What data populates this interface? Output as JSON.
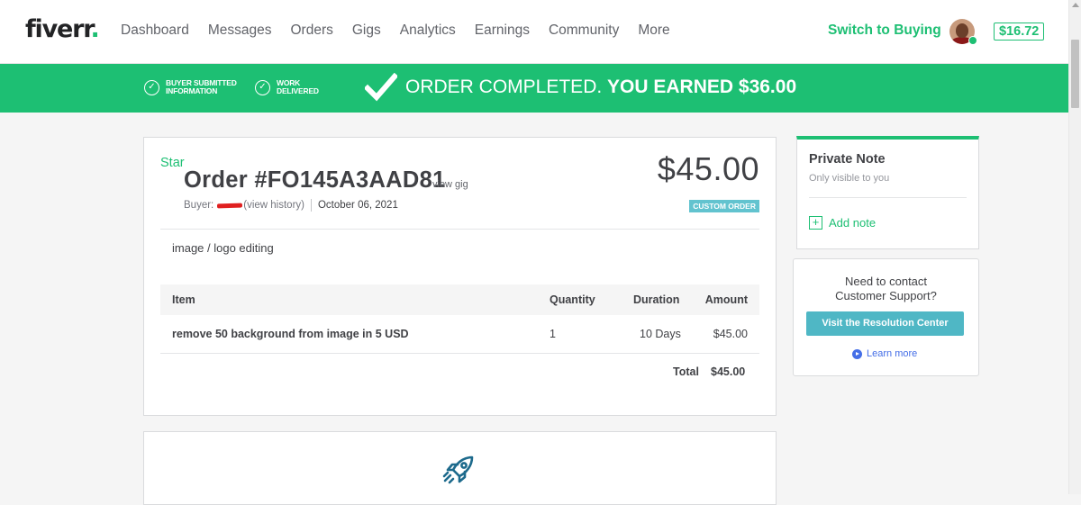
{
  "brand": {
    "logo_text": "fiverr",
    "logo_dot": ".",
    "accent": "#1dbf73"
  },
  "nav": {
    "links": [
      "Dashboard",
      "Messages",
      "Orders",
      "Gigs",
      "Analytics",
      "Earnings",
      "Community",
      "More"
    ],
    "switch_label": "Switch to Buying",
    "balance": "$16.72"
  },
  "banner": {
    "step1_line1": "BUYER SUBMITTED",
    "step1_line2": "INFORMATION",
    "step2_line1": "WORK",
    "step2_line2": "DELIVERED",
    "status_text": "ORDER COMPLETED.",
    "earned_text": "YOU EARNED $36.00"
  },
  "order": {
    "star_label": "Star",
    "title": "Order #FO145A3AAD81",
    "view_gig": "view gig",
    "buyer_label": "Buyer:",
    "view_history": "(view history)",
    "date": "October 06, 2021",
    "price": "$45.00",
    "badge": "CUSTOM ORDER",
    "description": "image / logo editing",
    "columns": {
      "item": "Item",
      "quantity": "Quantity",
      "duration": "Duration",
      "amount": "Amount"
    },
    "row": {
      "item": "remove 50 background from image in 5 USD",
      "quantity": "1",
      "duration": "10 Days",
      "amount": "$45.00"
    },
    "total_label": "Total",
    "total_value": "$45.00"
  },
  "private_note": {
    "title": "Private Note",
    "subtitle": "Only visible to you",
    "add_label": "Add note"
  },
  "support": {
    "question_line1": "Need to contact",
    "question_line2": "Customer Support?",
    "button_label": "Visit the Resolution Center",
    "learn_more": "Learn more"
  },
  "icons": {
    "banner_check": "check-icon",
    "next_section": "rocket-icon",
    "add_note": "plus-icon",
    "learn_more": "play-icon"
  }
}
